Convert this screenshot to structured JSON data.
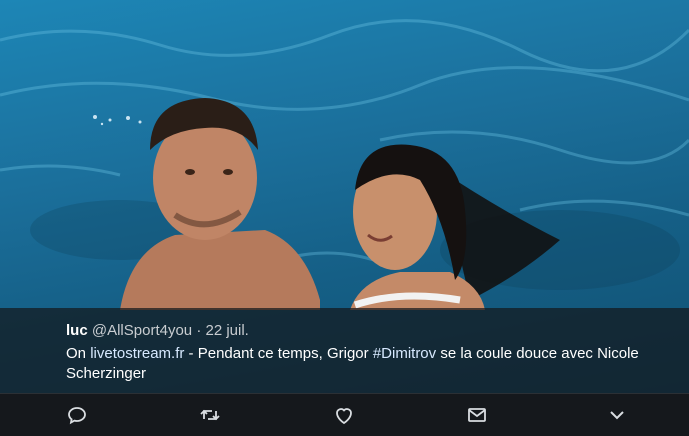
{
  "tweet": {
    "author_name": "luc",
    "author_handle": "@AllSport4you",
    "separator": "·",
    "date": "22 juil.",
    "text_prefix": "On ",
    "link_text": "livetostream.fr",
    "text_middle": " - Pendant ce temps, Grigor ",
    "hashtag": "#Dimitrov",
    "text_suffix": " se la coule douce avec Nicole Scherzinger"
  },
  "actions": {
    "reply_icon": "reply-icon",
    "retweet_icon": "retweet-icon",
    "like_icon": "heart-icon",
    "message_icon": "envelope-icon",
    "more_icon": "chevron-down-icon"
  },
  "colors": {
    "water": "#1b6f9b",
    "overlay": "#14181c",
    "link": "#d7e9ff"
  }
}
